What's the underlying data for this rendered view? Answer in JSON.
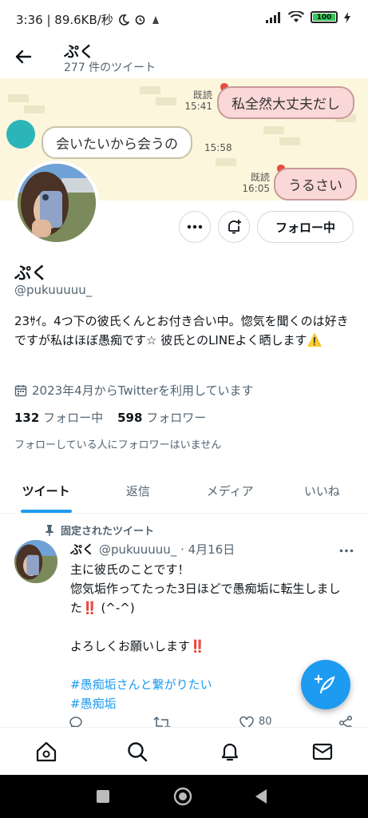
{
  "status_bar": {
    "time_speed": "3:36 | 89.6KB/秒",
    "battery": "100"
  },
  "header": {
    "name": "ぷく",
    "tweet_count": "277 件のツイート"
  },
  "banner": {
    "msg1": "私全然大丈夫だし",
    "msg1_read": "既読",
    "msg1_time": "15:41",
    "msg2": "会いたいから会うの",
    "msg2_time": "15:58",
    "msg3": "うるさい",
    "msg3_read": "既読",
    "msg3_time": "16:05"
  },
  "profile": {
    "follow_label": "フォロー中",
    "name": "ぷく",
    "handle": "@pukuuuuu_",
    "bio": "23ｻｲ。4つ下の彼氏くんとお付き合い中。惚気を聞くのは好きですが私はほぼ愚痴です☆ 彼氏とのLINEよく晒します⚠️",
    "joined": "2023年4月からTwitterを利用しています",
    "following_count": "132",
    "following_label": "フォロー中",
    "followers_count": "598",
    "followers_label": "フォロワー",
    "known_followers": "フォローしている人にフォロワーはいません"
  },
  "tabs": [
    "ツイート",
    "返信",
    "メディア",
    "いいね"
  ],
  "tweet": {
    "pinned_label": "固定されたツイート",
    "name": "ぷく",
    "handle_date": "@pukuuuuu_ · 4月16日",
    "line1": "主に彼氏のことです！",
    "line2": "惚気垢作ってたった3日ほどで愚痴垢に転生しました‼️ (^-^)",
    "line3": "よろしくお願いします‼️",
    "tag1": "#愚痴垢さんと繋がりたい",
    "tag2": "#愚痴垢",
    "likes": "80"
  },
  "icons": {
    "back": "arrow-left-icon",
    "more": "more-horizontal-icon",
    "notify": "bell-plus-icon",
    "calendar": "calendar-icon",
    "pin": "pin-icon",
    "compose": "feather-plus-icon",
    "home": "home-icon",
    "search": "search-icon",
    "notifications": "bell-icon",
    "messages": "mail-icon"
  },
  "colors": {
    "accent": "#1d9bf0",
    "banner_bg": "#fbf6dc",
    "bubble_pink": "#fbd8d8"
  }
}
